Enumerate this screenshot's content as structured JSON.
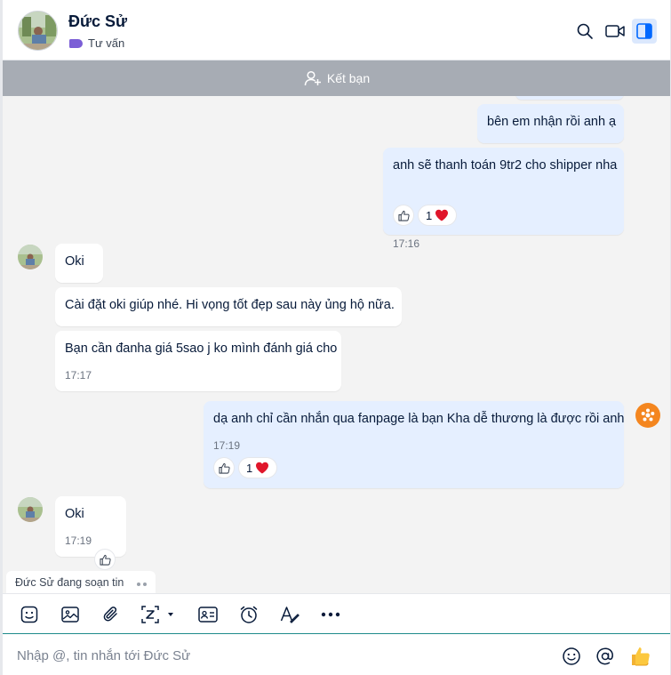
{
  "header": {
    "name": "Đức Sử",
    "tag": "Tư vấn",
    "tag_color": "#7b5ed6"
  },
  "friend_bar": {
    "label": "Kết bạn"
  },
  "messages": [
    {
      "side": "out",
      "text": "bên em nhận rồi anh ạ"
    },
    {
      "side": "out",
      "text": "anh sẽ thanh toán 9tr2 cho shipper nha",
      "time": "17:16",
      "reaction_count": "1"
    },
    {
      "side": "in",
      "text": "Oki"
    },
    {
      "side": "in",
      "text": "Cài đặt oki giúp nhé. Hi vọng tốt đẹp sau này ủng hộ nữa."
    },
    {
      "side": "in",
      "text": "Bạn cần đanha giá 5sao j ko mình đánh giá cho",
      "time": "17:17"
    },
    {
      "side": "out",
      "text": "dạ anh chỉ cần nhắn qua fanpage là bạn Kha dễ thương là được rồi anh",
      "time": "17:19",
      "reaction_count": "1"
    },
    {
      "side": "in",
      "text": "Oki",
      "time": "17:19"
    }
  ],
  "typing": {
    "label": "Đức Sử đang soạn tin"
  },
  "composer": {
    "placeholder": "Nhập @, tin nhắn tới Đức Sử"
  },
  "colors": {
    "outgoing_bubble": "#e5efff",
    "incoming_bubble": "#ffffff",
    "friend_bar": "#a7acb4",
    "bot_badge": "#f4861f",
    "heart": "#e0162b"
  }
}
